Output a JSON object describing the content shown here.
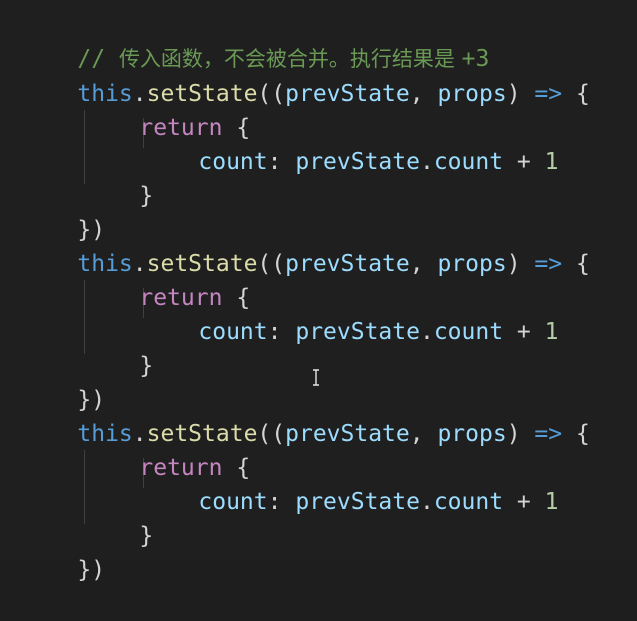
{
  "comment": {
    "slashes": "// ",
    "text": "传入函数，不会被合并。执行结果是 ",
    "suffix": "+3"
  },
  "calls": [
    {
      "this_kw": "this",
      "dot1": ".",
      "method": "setState",
      "open_parens": "((",
      "param1": "prevState",
      "comma": ", ",
      "param2": "props",
      "close_paren": ")",
      "arrow": " => ",
      "open_brace": "{",
      "return_kw": "return",
      "return_brace": " {",
      "prop_key": "count",
      "colon": ": ",
      "obj": "prevState",
      "dot2": ".",
      "prop": "count",
      "plus": " + ",
      "increment": "1",
      "inner_close": "}",
      "outer_close": "})"
    },
    {
      "this_kw": "this",
      "dot1": ".",
      "method": "setState",
      "open_parens": "((",
      "param1": "prevState",
      "comma": ", ",
      "param2": "props",
      "close_paren": ")",
      "arrow": " => ",
      "open_brace": "{",
      "return_kw": "return",
      "return_brace": " {",
      "prop_key": "count",
      "colon": ": ",
      "obj": "prevState",
      "dot2": ".",
      "prop": "count",
      "plus": " + ",
      "increment": "1",
      "inner_close": "}",
      "outer_close": "})"
    },
    {
      "this_kw": "this",
      "dot1": ".",
      "method": "setState",
      "open_parens": "((",
      "param1": "prevState",
      "comma": ", ",
      "param2": "props",
      "close_paren": ")",
      "arrow": " => ",
      "open_brace": "{",
      "return_kw": "return",
      "return_brace": " {",
      "prop_key": "count",
      "colon": ": ",
      "obj": "prevState",
      "dot2": ".",
      "prop": "count",
      "plus": " + ",
      "increment": "1",
      "inner_close": "}",
      "outer_close": "})"
    }
  ],
  "icons": {
    "cursor": "text-cursor-icon"
  },
  "colors": {
    "background": "#1f1f1f",
    "comment": "#6a9955",
    "keyword_blue": "#569cd6",
    "keyword_purple": "#c586c0",
    "function": "#dcdcaa",
    "variable": "#9cdcfe",
    "number": "#b5cea8",
    "punctuation": "#d4d4d4"
  }
}
